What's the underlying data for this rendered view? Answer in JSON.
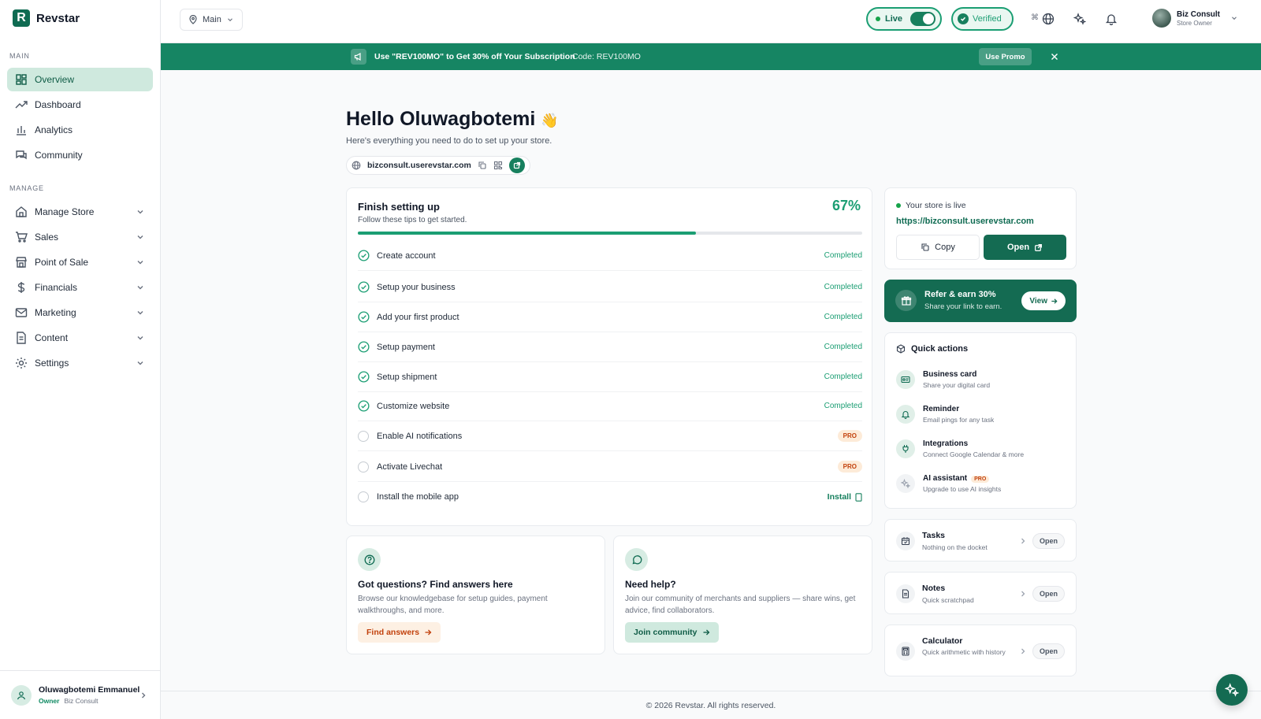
{
  "brand": {
    "name": "Revstar",
    "logo_letter": "R"
  },
  "sidebar": {
    "main_label": "MAIN",
    "manage_label": "MANAGE",
    "main_items": [
      {
        "label": "Overview",
        "icon": "grid-icon",
        "active": true
      },
      {
        "label": "Dashboard",
        "icon": "trending-icon"
      },
      {
        "label": "Analytics",
        "icon": "bar-chart-icon"
      },
      {
        "label": "Community",
        "icon": "chat-icon"
      }
    ],
    "manage_items": [
      {
        "label": "Manage Store",
        "icon": "store-icon"
      },
      {
        "label": "Sales",
        "icon": "cart-icon"
      },
      {
        "label": "Point of Sale",
        "icon": "shop-icon"
      },
      {
        "label": "Financials",
        "icon": "dollar-icon"
      },
      {
        "label": "Marketing",
        "icon": "mail-icon"
      },
      {
        "label": "Content",
        "icon": "document-icon"
      },
      {
        "label": "Settings",
        "icon": "gear-icon"
      }
    ],
    "user": {
      "name": "Oluwagbotemi Emmanuel",
      "role": "Owner",
      "org": "Biz Consult"
    }
  },
  "topbar": {
    "location": "Main",
    "live_label": "Live",
    "live_on": true,
    "verified_label": "Verified",
    "shortcut": "⌘",
    "user_name": "Biz Consult",
    "user_role": "Store Owner"
  },
  "promo": {
    "text": "Use \"REV100MO\" to Get 30% off Your Subscription",
    "code": "Code: REV100MO",
    "button": "Use Promo"
  },
  "greeting": {
    "title": "Hello Oluwagbotemi",
    "emoji": "👋",
    "subtitle": "Here's everything you need to do to set up your store.",
    "store_url": "bizconsult.userevstar.com"
  },
  "setup": {
    "title": "Finish setting up",
    "subtitle": "Follow these tips to get started.",
    "percent_label": "67%",
    "progress": 0.67,
    "tasks": [
      {
        "label": "Create account",
        "status": "Completed"
      },
      {
        "label": "Setup your business",
        "status": "Completed"
      },
      {
        "label": "Add your first product",
        "status": "Completed"
      },
      {
        "label": "Setup payment",
        "status": "Completed"
      },
      {
        "label": "Setup shipment",
        "status": "Completed"
      },
      {
        "label": "Customize website",
        "status": "Completed"
      },
      {
        "label": "Enable AI notifications",
        "status": "PRO"
      },
      {
        "label": "Activate Livechat",
        "status": "PRO"
      },
      {
        "label": "Install the mobile app",
        "status": "Install"
      }
    ]
  },
  "help": [
    {
      "title": "Got questions? Find answers here",
      "desc": "Browse our knowledgebase for setup guides, payment walkthroughs, and more.",
      "button": "Find answers"
    },
    {
      "title": "Need help?",
      "desc": "Join our community of merchants and suppliers — share wins, get advice, find collaborators.",
      "button": "Join community"
    }
  ],
  "live": {
    "status": "Your store is live",
    "url": "https://bizconsult.userevstar.com",
    "copy": "Copy",
    "open": "Open"
  },
  "refer": {
    "title": "Refer & earn 30%",
    "subtitle": "Share your link to earn.",
    "button": "View"
  },
  "quick_actions": {
    "title": "Quick actions",
    "items": [
      {
        "name": "Business card",
        "desc": "Share your digital card",
        "icon": "id-card-icon"
      },
      {
        "name": "Reminder",
        "desc": "Email pings for any task",
        "icon": "bell-icon"
      },
      {
        "name": "Integrations",
        "desc": "Connect Google Calendar & more",
        "icon": "plug-icon"
      },
      {
        "name": "AI assistant",
        "desc": "Upgrade to use AI insights",
        "icon": "sparkle-icon",
        "badge": "PRO"
      }
    ]
  },
  "tools": [
    {
      "name": "Tasks",
      "desc": "Nothing on the docket",
      "open": "Open"
    },
    {
      "name": "Notes",
      "desc": "Quick scratchpad",
      "open": "Open"
    },
    {
      "name": "Calculator",
      "desc": "Quick arithmetic with history",
      "open": "Open"
    }
  ],
  "footer": "© 2026 Revstar. All rights reserved.",
  "colors": {
    "brand": "#146b52",
    "accent": "#1b9e73",
    "pro": "#c2410c"
  }
}
